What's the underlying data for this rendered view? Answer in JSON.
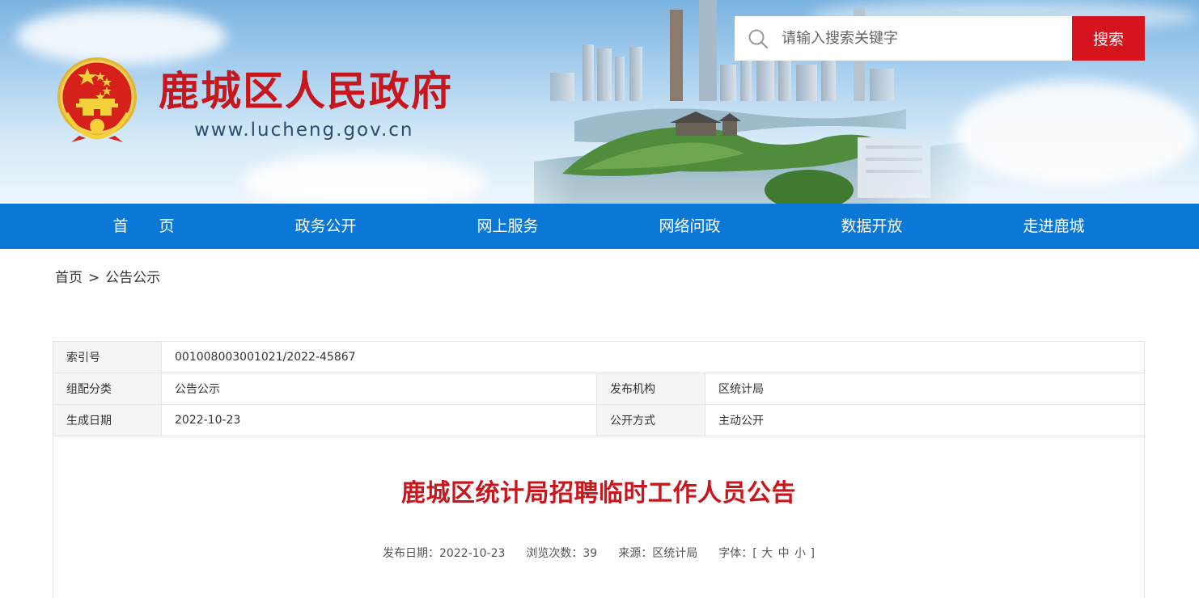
{
  "header": {
    "site_title": "鹿城区人民政府",
    "site_url": "www.lucheng.gov.cn",
    "emblem_icon": "national-emblem-icon",
    "search": {
      "placeholder": "请输入搜索关键字",
      "value": "",
      "button_label": "搜索",
      "icon": "search-icon"
    }
  },
  "colors": {
    "brand_red": "#c8161d",
    "nav_blue": "#0b78d8",
    "search_button_red": "#d6141e"
  },
  "nav": {
    "items": [
      {
        "label": "首　　页"
      },
      {
        "label": "政务公开"
      },
      {
        "label": "网上服务"
      },
      {
        "label": "网络问政"
      },
      {
        "label": "数据开放"
      },
      {
        "label": "走进鹿城"
      }
    ]
  },
  "breadcrumb": {
    "home": "首页",
    "separator": ">",
    "current": "公告公示"
  },
  "info_table": {
    "index_label": "索引号",
    "index_value": "001008003001021/2022-45867",
    "category_label": "组配分类",
    "category_value": "公告公示",
    "publisher_label": "发布机构",
    "publisher_value": "区统计局",
    "date_label": "生成日期",
    "date_value": "2022-10-23",
    "method_label": "公开方式",
    "method_value": "主动公开"
  },
  "article": {
    "title": "鹿城区统计局招聘临时工作人员公告",
    "meta": {
      "publish_date_label": "发布日期：",
      "publish_date": "2022-10-23",
      "views_label": "浏览次数：",
      "views": "39",
      "source_label": "来源：",
      "source": "区统计局",
      "font_label": "字体：",
      "bracket_open": "[",
      "size_large": "大",
      "size_medium": "中",
      "size_small": "小",
      "bracket_close": "]"
    }
  }
}
